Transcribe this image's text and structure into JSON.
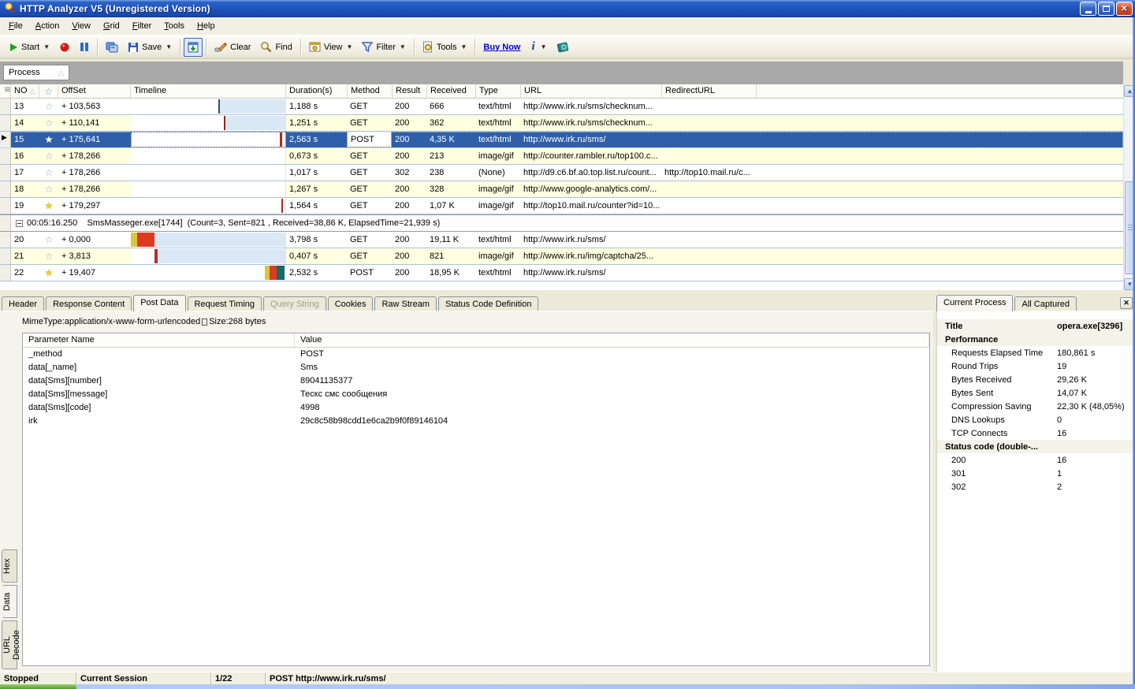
{
  "window": {
    "title": "HTTP Analyzer V5  (Unregistered Version)"
  },
  "menu": {
    "items": [
      "File",
      "Action",
      "View",
      "Grid",
      "Filter",
      "Tools",
      "Help"
    ]
  },
  "toolbar": {
    "start_label": "Start",
    "save_label": "Save",
    "clear_label": "Clear",
    "find_label": "Find",
    "view_label": "View",
    "filter_label": "Filter",
    "tools_label": "Tools",
    "buy_now_label": "Buy Now",
    "info_label": "i"
  },
  "group_bar": {
    "label": "Process"
  },
  "grid": {
    "columns": [
      "NO",
      "star",
      "OffSet",
      "Timeline",
      "Duration(s)",
      "Method",
      "Result",
      "Received",
      "Type",
      "URL",
      "RedirectURL"
    ],
    "group_row": {
      "text": "00:05:16.250    SmsMasseger.exe[1744]  (Count=3, Sent=821 , Received=38,86 K, ElapsedTime=21,939 s)"
    },
    "rows": [
      {
        "no": "13",
        "star": "outline",
        "offset": "+ 103,563",
        "duration": "1,188 s",
        "method": "GET",
        "result": "200",
        "received": "666",
        "type": "text/html",
        "url": "http://www.irk.ru/sms/checknum...",
        "redirect": "",
        "zebra": false,
        "selected": false,
        "group_break_before": false,
        "timeline": {
          "segments": [
            {
              "x": 0.565,
              "w": 0.008,
              "color": "#33506e"
            }
          ],
          "fill_from": 0.573
        }
      },
      {
        "no": "14",
        "star": "outline",
        "offset": "+ 110,141",
        "duration": "1,251 s",
        "method": "GET",
        "result": "200",
        "received": "362",
        "type": "text/html",
        "url": "http://www.irk.ru/sms/checknum...",
        "redirect": "",
        "zebra": true,
        "selected": false,
        "group_break_before": false,
        "timeline": {
          "segments": [
            {
              "x": 0.6,
              "w": 0.01,
              "color": "#8c2a1c"
            }
          ],
          "fill_from": 0.61
        }
      },
      {
        "no": "15",
        "star": "white",
        "offset": "+ 175,641",
        "duration": "2,563 s",
        "method": "POST",
        "result": "200",
        "received": "4,35 K",
        "type": "text/html",
        "url": "http://www.irk.ru/sms/",
        "redirect": "",
        "zebra": false,
        "selected": true,
        "group_break_before": false,
        "timeline": {
          "segments": [
            {
              "x": 0.963,
              "w": 0.015,
              "color": "#a63020"
            }
          ],
          "fill_from": null
        }
      },
      {
        "no": "16",
        "star": "outline",
        "offset": "+ 178,266",
        "duration": "0,673 s",
        "method": "GET",
        "result": "200",
        "received": "213",
        "type": "image/gif",
        "url": "http://counter.rambler.ru/top100.c...",
        "redirect": "",
        "zebra": true,
        "selected": false,
        "group_break_before": false,
        "timeline": {
          "segments": [],
          "fill_from": null
        }
      },
      {
        "no": "17",
        "star": "outline",
        "offset": "+ 178,266",
        "duration": "1,017 s",
        "method": "GET",
        "result": "302",
        "received": "238",
        "type": "(None)",
        "url": "http://d9.c6.bf.a0.top.list.ru/count...",
        "redirect": "http://top10.mail.ru/c...",
        "zebra": false,
        "selected": false,
        "group_break_before": false,
        "timeline": {
          "segments": [],
          "fill_from": null
        }
      },
      {
        "no": "18",
        "star": "outline",
        "offset": "+ 178,266",
        "duration": "1,267 s",
        "method": "GET",
        "result": "200",
        "received": "328",
        "type": "image/gif",
        "url": "http://www.google-analytics.com/...",
        "redirect": "",
        "zebra": true,
        "selected": false,
        "group_break_before": false,
        "timeline": {
          "segments": [],
          "fill_from": null
        }
      },
      {
        "no": "19",
        "star": "gold",
        "offset": "+ 179,297",
        "duration": "1,564 s",
        "method": "GET",
        "result": "200",
        "received": "1,07 K",
        "type": "image/gif",
        "url": "http://top10.mail.ru/counter?id=10...",
        "redirect": "",
        "zebra": false,
        "selected": false,
        "group_break_before": false,
        "timeline": {
          "segments": [
            {
              "x": 0.972,
              "w": 0.012,
              "color": "#a63020"
            }
          ],
          "fill_from": null
        }
      },
      {
        "no": "20",
        "star": "outline",
        "offset": "+ 0,000",
        "duration": "3,798 s",
        "method": "GET",
        "result": "200",
        "received": "19,11 K",
        "type": "text/html",
        "url": "http://www.irk.ru/sms/",
        "redirect": "",
        "zebra": false,
        "selected": false,
        "group_break_before": true,
        "timeline": {
          "segments": [
            {
              "x": 0.0,
              "w": 0.04,
              "color": "#d8c838"
            },
            {
              "x": 0.04,
              "w": 0.115,
              "color": "#dd3a22"
            }
          ],
          "fill_from": 0.155
        }
      },
      {
        "no": "21",
        "star": "outline",
        "offset": "+ 3,813",
        "duration": "0,407 s",
        "method": "GET",
        "result": "200",
        "received": "821",
        "type": "image/gif",
        "url": "http://www.irk.ru/img/captcha/25...",
        "redirect": "",
        "zebra": true,
        "selected": false,
        "group_break_before": false,
        "timeline": {
          "segments": [
            {
              "x": 0.155,
              "w": 0.018,
              "color": "#b43224"
            }
          ],
          "fill_from": 0.173
        }
      },
      {
        "no": "22",
        "star": "gold",
        "offset": "+ 19,407",
        "duration": "2,532 s",
        "method": "POST",
        "result": "200",
        "received": "18,95 K",
        "type": "text/html",
        "url": "http://www.irk.ru/sms/",
        "redirect": "",
        "zebra": false,
        "selected": false,
        "group_break_before": false,
        "timeline": {
          "segments": [
            {
              "x": 0.868,
              "w": 0.03,
              "color": "#d8c838"
            },
            {
              "x": 0.898,
              "w": 0.046,
              "color": "#dd3a22"
            },
            {
              "x": 0.944,
              "w": 0.05,
              "color": "#176868"
            }
          ],
          "fill_from": null
        }
      }
    ]
  },
  "detail": {
    "tabs": [
      {
        "label": "Header",
        "active": false,
        "disabled": false
      },
      {
        "label": "Response Content",
        "active": false,
        "disabled": false
      },
      {
        "label": "Post Data",
        "active": true,
        "disabled": false
      },
      {
        "label": "Request Timing",
        "active": false,
        "disabled": false
      },
      {
        "label": "Query String",
        "active": false,
        "disabled": true
      },
      {
        "label": "Cookies",
        "active": false,
        "disabled": false
      },
      {
        "label": "Raw Stream",
        "active": false,
        "disabled": false
      },
      {
        "label": "Status Code Definition",
        "active": false,
        "disabled": false
      }
    ],
    "mime_line": {
      "mime": "MimeType:application/x-www-form-urlencoded",
      "size": "Size:268 bytes"
    },
    "param_table": {
      "headers": [
        "Parameter Name",
        "Value"
      ],
      "rows": [
        [
          "_method",
          "POST"
        ],
        [
          "data[_name]",
          "Sms"
        ],
        [
          "data[Sms][number]",
          "89041135377"
        ],
        [
          "data[Sms][message]",
          "Тескс смс сообщения"
        ],
        [
          "data[Sms][code]",
          "4998"
        ],
        [
          "irk",
          "29c8c58b98cdd1e6ca2b9f0f89146104"
        ]
      ]
    },
    "side_tabs": [
      {
        "label": "Hex",
        "active": false
      },
      {
        "label": "Data",
        "active": true
      },
      {
        "label": "URL Decode",
        "active": false
      }
    ]
  },
  "right_panel": {
    "tabs": [
      {
        "label": "Current Process",
        "active": true
      },
      {
        "label": "All Captured",
        "active": false
      }
    ],
    "rows": [
      {
        "label": "Title",
        "value": "opera.exe[3296]",
        "section": true
      },
      {
        "label": "Performance",
        "value": "",
        "section": true
      },
      {
        "label": "Requests Elapsed Time",
        "value": "180,861 s",
        "section": false
      },
      {
        "label": "Round Trips",
        "value": "19",
        "section": false
      },
      {
        "label": "Bytes Received",
        "value": "29,26 K",
        "section": false
      },
      {
        "label": "Bytes Sent",
        "value": "14,07 K",
        "section": false
      },
      {
        "label": "Compression Saving",
        "value": "22,30 K (48,05%)",
        "section": false
      },
      {
        "label": "DNS Lookups",
        "value": "0",
        "section": false
      },
      {
        "label": "TCP Connects",
        "value": "16",
        "section": false
      },
      {
        "label": "Status code (double-...",
        "value": "",
        "section": true
      },
      {
        "label": "200",
        "value": "16",
        "section": false
      },
      {
        "label": "301",
        "value": "1",
        "section": false
      },
      {
        "label": "302",
        "value": "2",
        "section": false
      }
    ]
  },
  "status_bar": {
    "items": [
      "Stopped",
      "Current Session",
      "1/22",
      "POST  http://www.irk.ru/sms/"
    ]
  },
  "colors": {
    "selection": "#2e5fa8",
    "zebra": "#ffffe1",
    "timeline_fill": "#dae8f6",
    "titlebar": "#1f55bd"
  }
}
